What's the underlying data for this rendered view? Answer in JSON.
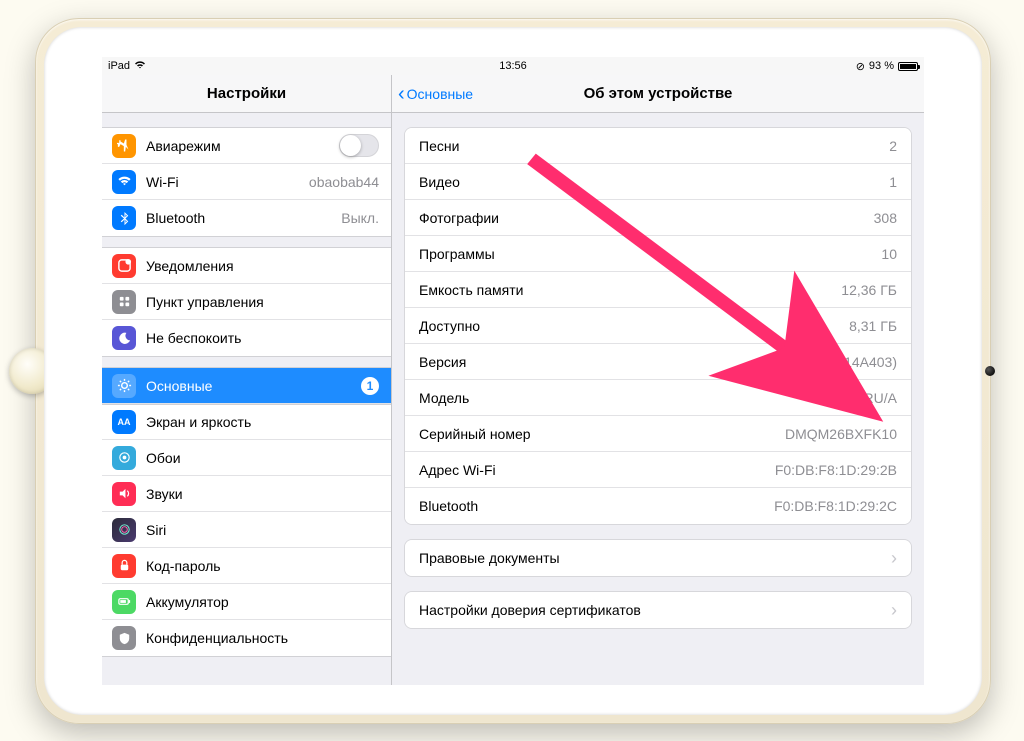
{
  "status": {
    "device": "iPad",
    "time": "13:56",
    "orientation_lock": "⊘",
    "battery_pct": "93 %"
  },
  "sidebar": {
    "title": "Настройки",
    "airplane": {
      "label": "Авиарежим",
      "on": false
    },
    "wifi": {
      "label": "Wi-Fi",
      "value": "obaobab44"
    },
    "bluetooth": {
      "label": "Bluetooth",
      "value": "Выкл."
    },
    "notifications": {
      "label": "Уведомления"
    },
    "control_center": {
      "label": "Пункт управления"
    },
    "dnd": {
      "label": "Не беспокоить"
    },
    "general": {
      "label": "Основные",
      "badge": "1"
    },
    "display": {
      "label": "Экран и яркость"
    },
    "wallpaper": {
      "label": "Обои"
    },
    "sounds": {
      "label": "Звуки"
    },
    "siri": {
      "label": "Siri"
    },
    "passcode": {
      "label": "Код-пароль"
    },
    "battery": {
      "label": "Аккумулятор"
    },
    "privacy": {
      "label": "Конфиденциальность"
    }
  },
  "header": {
    "back": "Основные",
    "title": "Об этом устройстве"
  },
  "about": {
    "songs": {
      "k": "Песни",
      "v": "2"
    },
    "videos": {
      "k": "Видео",
      "v": "1"
    },
    "photos": {
      "k": "Фотографии",
      "v": "308"
    },
    "apps": {
      "k": "Программы",
      "v": "10"
    },
    "capacity": {
      "k": "Емкость памяти",
      "v": "12,36 ГБ"
    },
    "available": {
      "k": "Доступно",
      "v": "8,31 ГБ"
    },
    "version": {
      "k": "Версия",
      "v": "10.0.1 (14A403)"
    },
    "model": {
      "k": "Модель",
      "v": "MD785RU/A"
    },
    "serial": {
      "k": "Серийный номер",
      "v": "DMQM26BXFK10"
    },
    "wifi_addr": {
      "k": "Адрес Wi-Fi",
      "v": "F0:DB:F8:1D:29:2B"
    },
    "bt_addr": {
      "k": "Bluetooth",
      "v": "F0:DB:F8:1D:29:2C"
    }
  },
  "links": {
    "legal": "Правовые документы",
    "cert_trust": "Настройки доверия сертификатов"
  },
  "colors": {
    "accent": "#007aff",
    "selected": "#1e8cff",
    "arrow": "#ff2d6e"
  }
}
